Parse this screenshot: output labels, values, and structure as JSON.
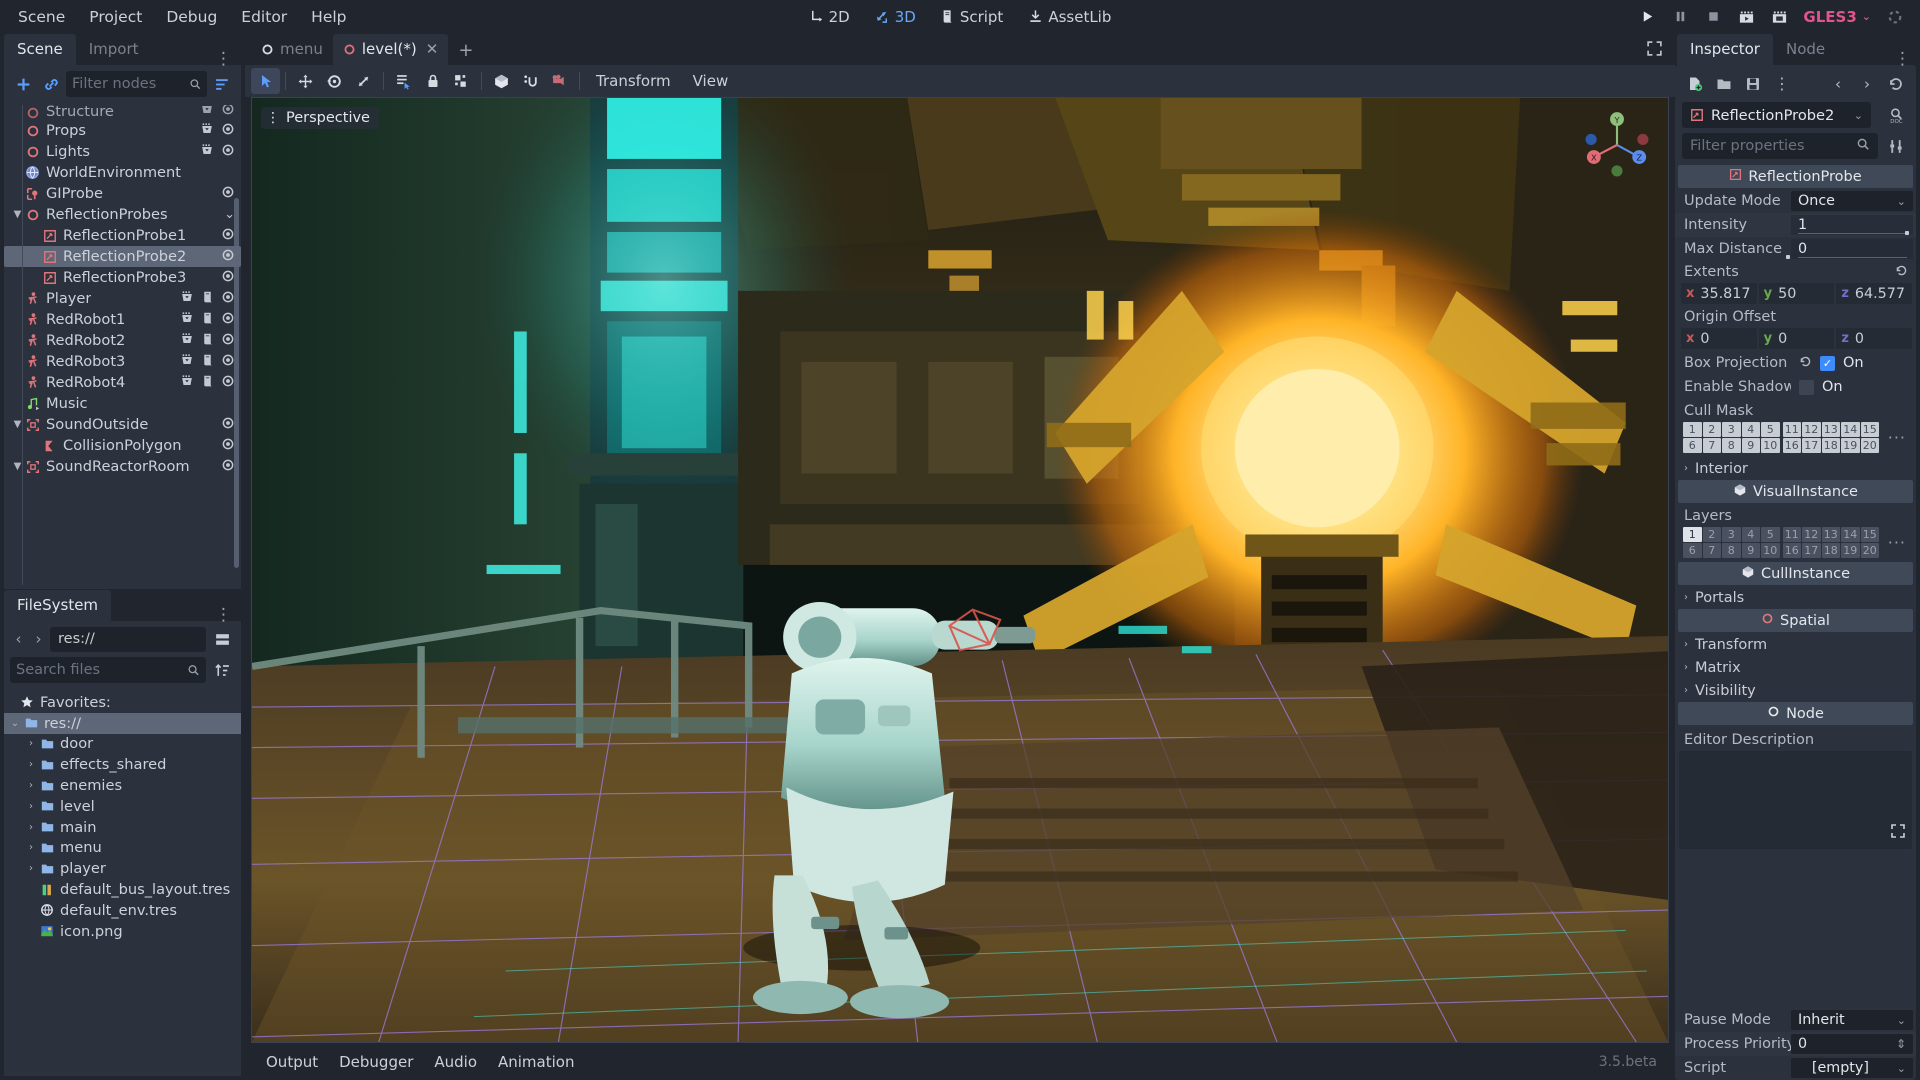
{
  "menubar": {
    "items": [
      "Scene",
      "Project",
      "Debug",
      "Editor",
      "Help"
    ],
    "modes": [
      {
        "label": "2D",
        "icon": "move-2d-icon",
        "active": false
      },
      {
        "label": "3D",
        "icon": "move-3d-icon",
        "active": true
      },
      {
        "label": "Script",
        "icon": "script-icon",
        "active": false
      },
      {
        "label": "AssetLib",
        "icon": "download-icon",
        "active": false
      }
    ],
    "playback": [
      {
        "name": "play-button",
        "icon": "play-icon"
      },
      {
        "name": "pause-button",
        "icon": "pause-icon"
      },
      {
        "name": "stop-button",
        "icon": "stop-icon"
      },
      {
        "name": "play-scene-button",
        "icon": "play-scene-icon"
      },
      {
        "name": "play-custom-scene-button",
        "icon": "play-custom-icon"
      }
    ],
    "renderer": "GLES3",
    "renderer_color": "#e0558a"
  },
  "scene_dock": {
    "tabs": [
      {
        "label": "Scene",
        "active": true
      },
      {
        "label": "Import",
        "active": false
      }
    ],
    "toolbar": {
      "add_node": "add-node-button",
      "link_scene": "instance-scene-button",
      "filter_placeholder": "Filter nodes",
      "search_icon": "search-icon",
      "tree_options": "tree-options-button"
    },
    "nodes": [
      {
        "label": "Structure",
        "icon": "spatial",
        "depth": 1,
        "arrow": "",
        "selected": false,
        "partial": true,
        "btns": [
          "group",
          "visibility"
        ]
      },
      {
        "label": "Props",
        "icon": "spatial",
        "depth": 1,
        "arrow": "",
        "selected": false,
        "btns": [
          "group",
          "visibility"
        ]
      },
      {
        "label": "Lights",
        "icon": "spatial",
        "depth": 1,
        "arrow": "",
        "selected": false,
        "btns": [
          "group",
          "visibility"
        ]
      },
      {
        "label": "WorldEnvironment",
        "icon": "world",
        "depth": 1,
        "arrow": "",
        "selected": false,
        "btns": []
      },
      {
        "label": "GIProbe",
        "icon": "giprobe",
        "depth": 1,
        "arrow": "",
        "selected": false,
        "btns": [
          "visibility"
        ]
      },
      {
        "label": "ReflectionProbes",
        "icon": "spatial",
        "depth": 1,
        "arrow": "▼",
        "selected": false,
        "btns": [
          "chevron"
        ]
      },
      {
        "label": "ReflectionProbe1",
        "icon": "reflectionprobe",
        "depth": 2,
        "arrow": "",
        "selected": false,
        "btns": [
          "visibility"
        ]
      },
      {
        "label": "ReflectionProbe2",
        "icon": "reflectionprobe",
        "depth": 2,
        "arrow": "",
        "selected": true,
        "btns": [
          "visibility"
        ]
      },
      {
        "label": "ReflectionProbe3",
        "icon": "reflectionprobe",
        "depth": 2,
        "arrow": "",
        "selected": false,
        "btns": [
          "visibility"
        ]
      },
      {
        "label": "Player",
        "icon": "kinematic",
        "depth": 1,
        "arrow": "",
        "selected": false,
        "btns": [
          "group",
          "script",
          "visibility"
        ]
      },
      {
        "label": "RedRobot1",
        "icon": "kinematic",
        "depth": 1,
        "arrow": "",
        "selected": false,
        "btns": [
          "group",
          "script",
          "visibility"
        ]
      },
      {
        "label": "RedRobot2",
        "icon": "kinematic",
        "depth": 1,
        "arrow": "",
        "selected": false,
        "btns": [
          "group",
          "script",
          "visibility"
        ]
      },
      {
        "label": "RedRobot3",
        "icon": "kinematic",
        "depth": 1,
        "arrow": "",
        "selected": false,
        "btns": [
          "group",
          "script",
          "visibility"
        ]
      },
      {
        "label": "RedRobot4",
        "icon": "kinematic",
        "depth": 1,
        "arrow": "",
        "selected": false,
        "btns": [
          "group",
          "script",
          "visibility"
        ]
      },
      {
        "label": "Music",
        "icon": "audio",
        "depth": 1,
        "arrow": "",
        "selected": false,
        "btns": []
      },
      {
        "label": "SoundOutside",
        "icon": "area",
        "depth": 1,
        "arrow": "▼",
        "selected": false,
        "btns": [
          "visibility"
        ]
      },
      {
        "label": "CollisionPolygon",
        "icon": "collisionpolygon",
        "depth": 2,
        "arrow": "",
        "selected": false,
        "btns": [
          "visibility"
        ]
      },
      {
        "label": "SoundReactorRoom",
        "icon": "area",
        "depth": 1,
        "arrow": "▼",
        "selected": false,
        "btns": [
          "visibility"
        ]
      }
    ]
  },
  "filesystem": {
    "tab": "FileSystem",
    "path": "res://",
    "search_placeholder": "Search files",
    "favorites_label": "Favorites:",
    "entries": [
      {
        "label": "res://",
        "type": "folder-root",
        "depth": 1,
        "arrow": "⌄",
        "selected": true
      },
      {
        "label": "door",
        "type": "folder",
        "depth": 2,
        "arrow": "›",
        "selected": false
      },
      {
        "label": "effects_shared",
        "type": "folder",
        "depth": 2,
        "arrow": "›",
        "selected": false
      },
      {
        "label": "enemies",
        "type": "folder",
        "depth": 2,
        "arrow": "›",
        "selected": false
      },
      {
        "label": "level",
        "type": "folder",
        "depth": 2,
        "arrow": "›",
        "selected": false
      },
      {
        "label": "main",
        "type": "folder",
        "depth": 2,
        "arrow": "›",
        "selected": false
      },
      {
        "label": "menu",
        "type": "folder",
        "depth": 2,
        "arrow": "›",
        "selected": false
      },
      {
        "label": "player",
        "type": "folder",
        "depth": 2,
        "arrow": "›",
        "selected": false
      },
      {
        "label": "default_bus_layout.tres",
        "type": "audiobus",
        "depth": 2,
        "arrow": "",
        "selected": false
      },
      {
        "label": "default_env.tres",
        "type": "environment",
        "depth": 2,
        "arrow": "",
        "selected": false
      },
      {
        "label": "icon.png",
        "type": "image",
        "depth": 2,
        "arrow": "",
        "selected": false
      }
    ]
  },
  "scene_tabs": {
    "tabs": [
      {
        "label": "menu",
        "active": false,
        "modified": false,
        "dot_color": "#d7dae0"
      },
      {
        "label": "level(*)",
        "active": true,
        "modified": true,
        "dot_color": "#e06c75"
      }
    ],
    "add_label": "+",
    "expand_icon": "expand-icon"
  },
  "viewport_toolbar": {
    "tools": [
      {
        "name": "select-mode-button",
        "icon": "cursor-icon",
        "active": true
      },
      {
        "name": "move-mode-button",
        "icon": "move-icon",
        "active": false
      },
      {
        "name": "rotate-mode-button",
        "icon": "rotate-icon",
        "active": false
      },
      {
        "name": "scale-mode-button",
        "icon": "scale-icon",
        "active": false
      },
      {
        "name": "list-select-button",
        "icon": "list-select-icon",
        "active": false
      },
      {
        "name": "lock-button",
        "icon": "lock-icon",
        "active": false
      },
      {
        "name": "group-button",
        "icon": "group-icon",
        "active": false
      },
      {
        "name": "use-local-space-button",
        "icon": "cube-icon",
        "active": false
      },
      {
        "name": "snap-mode-button",
        "icon": "snap-icon",
        "active": false
      },
      {
        "name": "camera-preview-button",
        "icon": "camera-icon",
        "active": false
      }
    ],
    "menus": [
      "Transform",
      "View"
    ]
  },
  "viewport": {
    "perspective_label": "Perspective",
    "gizmo_axes": [
      {
        "label": "X",
        "color": "#e06c75"
      },
      {
        "label": "Y",
        "color": "#8ec07c"
      },
      {
        "label": "Z",
        "color": "#5b8dee"
      }
    ]
  },
  "bottom_panel": {
    "items": [
      "Output",
      "Debugger",
      "Audio",
      "Animation"
    ],
    "version": "3.5.beta"
  },
  "inspector": {
    "tabs": [
      {
        "label": "Inspector",
        "active": true
      },
      {
        "label": "Node",
        "active": false
      }
    ],
    "toolbar": {
      "new_resource": "new-resource-icon",
      "load": "folder-open-icon",
      "save": "save-icon",
      "more": "more-options-icon",
      "back": "back-icon",
      "forward": "forward-icon",
      "history": "history-icon"
    },
    "node_name": "ReflectionProbe2",
    "node_icon": "reflectionprobe-icon",
    "doc_button": "open-docs-icon",
    "filter_placeholder": "Filter properties",
    "tool_button": "object-tools-icon",
    "sections": [
      {
        "type": "category",
        "title": "ReflectionProbe",
        "icon": "reflectionprobe-icon"
      },
      {
        "type": "dropdown",
        "label": "Update Mode",
        "value": "Once"
      },
      {
        "type": "slider",
        "label": "Intensity",
        "value": "1",
        "fill": 0.985
      },
      {
        "type": "slider",
        "label": "Max Distance",
        "value": "0",
        "fill": 0.015
      },
      {
        "type": "vector_label",
        "label": "Extents",
        "reset": true
      },
      {
        "type": "vector3",
        "x": "35.817",
        "y": "50",
        "z": "64.577"
      },
      {
        "type": "vector_label",
        "label": "Origin Offset",
        "reset": false
      },
      {
        "type": "vector3",
        "x": "0",
        "y": "0",
        "z": "0"
      },
      {
        "type": "checkbox",
        "label": "Box Projection",
        "checked": true,
        "value": "On",
        "reset": true
      },
      {
        "type": "checkbox",
        "label": "Enable Shadows",
        "checked": false,
        "value": "On",
        "reset": false
      },
      {
        "type": "mask",
        "label": "Cull Mask",
        "active": []
      },
      {
        "type": "expandable",
        "label": "Interior"
      },
      {
        "type": "category",
        "title": "VisualInstance",
        "icon": "cube-icon"
      },
      {
        "type": "mask",
        "label": "Layers",
        "active": [
          "1"
        ]
      },
      {
        "type": "category",
        "title": "CullInstance",
        "icon": "cube-icon"
      },
      {
        "type": "expandable",
        "label": "Portals"
      },
      {
        "type": "category",
        "title": "Spatial",
        "icon": "spatial-icon"
      },
      {
        "type": "expandable",
        "label": "Transform"
      },
      {
        "type": "expandable",
        "label": "Matrix"
      },
      {
        "type": "expandable",
        "label": "Visibility"
      },
      {
        "type": "category",
        "title": "Node",
        "icon": "node-icon"
      },
      {
        "type": "description",
        "label": "Editor Description",
        "value": ""
      }
    ],
    "footer": [
      {
        "type": "dropdown",
        "label": "Pause Mode",
        "value": "Inherit"
      },
      {
        "type": "spin",
        "label": "Process Priority",
        "value": "0"
      },
      {
        "type": "dropdown",
        "label": "Script",
        "value": "[empty]",
        "centered": true
      }
    ],
    "mask_cells": {
      "left": [
        [
          "1",
          "2",
          "3",
          "4",
          "5"
        ],
        [
          "6",
          "7",
          "8",
          "9",
          "10"
        ]
      ],
      "right": [
        [
          "11",
          "12",
          "13",
          "14",
          "15"
        ],
        [
          "16",
          "17",
          "18",
          "19",
          "20"
        ]
      ],
      "overflow": "···"
    }
  },
  "colors": {
    "panel_bg": "#2b313d",
    "window_bg": "#21252e",
    "accent": "#3d8bfd",
    "node_red": "#e06c75",
    "selection": "#5d6778",
    "category_bg": "#404958",
    "text": "#c9cdd6",
    "text_dim": "#7b828f"
  }
}
